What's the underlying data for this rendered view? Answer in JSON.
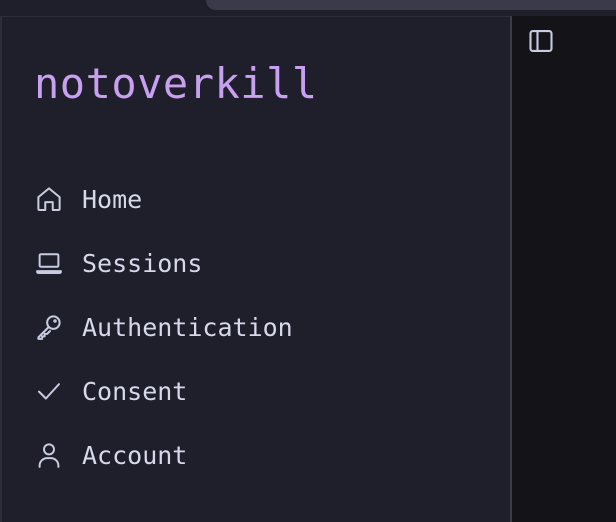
{
  "brand": {
    "title": "notoverkill"
  },
  "nav": {
    "items": [
      {
        "label": "Home",
        "icon": "home-icon"
      },
      {
        "label": "Sessions",
        "icon": "laptop-icon"
      },
      {
        "label": "Authentication",
        "icon": "key-icon"
      },
      {
        "label": "Consent",
        "icon": "check-icon"
      },
      {
        "label": "Account",
        "icon": "user-icon"
      }
    ]
  },
  "main": {
    "toggle_icon": "sidebar-toggle-icon"
  },
  "colors": {
    "brand": "#c9a0f0",
    "sidebar_bg": "#1f1f2c",
    "main_bg": "#131318",
    "text": "#d6d9ea"
  }
}
